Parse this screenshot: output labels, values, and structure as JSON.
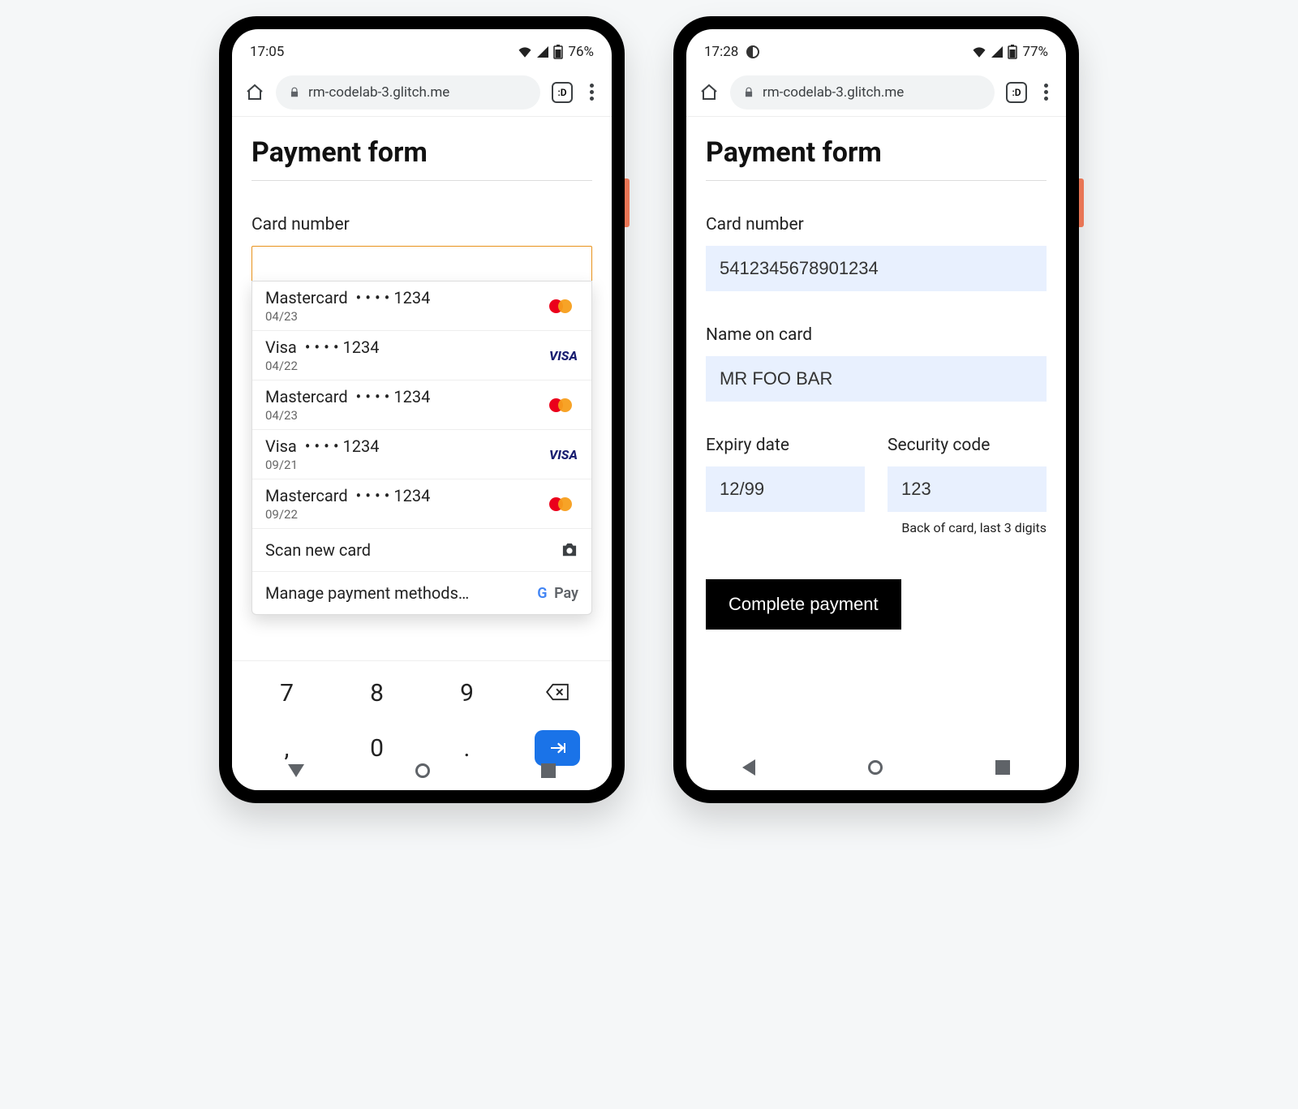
{
  "phone1": {
    "status": {
      "time": "17:05",
      "battery": "76%"
    },
    "browser": {
      "url": "rm-codelab-3.glitch.me",
      "tabcount": ":D"
    },
    "title": "Payment form",
    "card_number_label": "Card number",
    "card_number_value": "",
    "autofill": {
      "cards": [
        {
          "brand": "Mastercard",
          "mask": "• • • • 1234",
          "exp": "04/23",
          "type": "mc"
        },
        {
          "brand": "Visa",
          "mask": "• • • •  1234",
          "exp": "04/22",
          "type": "visa"
        },
        {
          "brand": "Mastercard",
          "mask": "• • • • 1234",
          "exp": "04/23",
          "type": "mc"
        },
        {
          "brand": "Visa",
          "mask": "• • • •  1234",
          "exp": "09/21",
          "type": "visa"
        },
        {
          "brand": "Mastercard",
          "mask": "• • • • 1234",
          "exp": "09/22",
          "type": "mc"
        }
      ],
      "scan": "Scan new card",
      "manage": "Manage payment methods…"
    },
    "keypad": [
      "7",
      "8",
      "9",
      "⌫",
      ",",
      "0",
      ".",
      "→"
    ]
  },
  "phone2": {
    "status": {
      "time": "17:28",
      "battery": "77%"
    },
    "browser": {
      "url": "rm-codelab-3.glitch.me",
      "tabcount": ":D"
    },
    "title": "Payment form",
    "card_number_label": "Card number",
    "card_number_value": "5412345678901234",
    "name_label": "Name on card",
    "name_value": "MR FOO BAR",
    "expiry_label": "Expiry date",
    "expiry_value": "12/99",
    "cvc_label": "Security code",
    "cvc_value": "123",
    "cvc_helper": "Back of card, last 3 digits",
    "submit": "Complete payment"
  }
}
